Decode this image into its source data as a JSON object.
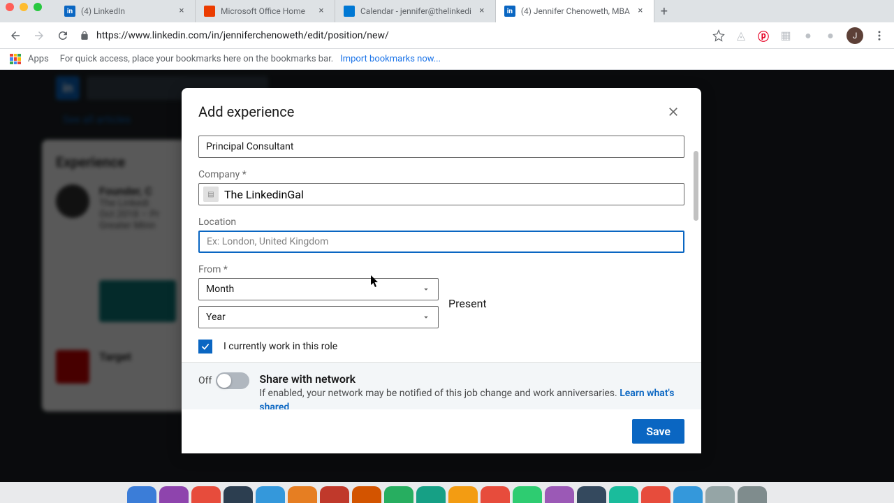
{
  "browser": {
    "tabs": [
      {
        "title": "(4) LinkedIn"
      },
      {
        "title": "Microsoft Office Home"
      },
      {
        "title": "Calendar - jennifer@thelinkedi"
      },
      {
        "title": "(4) Jennifer Chenoweth, MBA"
      }
    ],
    "url": "https://www.linkedin.com/in/jenniferchenoweth/edit/position/new/",
    "appsLabel": "Apps",
    "bookmarkHint": "For quick access, place your bookmarks here on the bookmarks bar.",
    "importLink": "Import bookmarks now...",
    "avatar": "J"
  },
  "background": {
    "seeAll": "See all articles",
    "sectionTitle": "Experience",
    "exp1_title": "Founder, C",
    "exp1_company": "The Linkedi",
    "exp2_title": "Target"
  },
  "modal": {
    "title": "Add experience",
    "titleValue": "Principal Consultant",
    "companyLabel": "Company",
    "companyValue": "The LinkedinGal",
    "locationLabel": "Location",
    "locationPlaceholder": "Ex: London, United Kingdom",
    "fromLabel": "From",
    "monthPlaceholder": "Month",
    "yearPlaceholder": "Year",
    "presentLabel": "Present",
    "currentRoleLabel": "I currently work in this role",
    "share": {
      "offLabel": "Off",
      "title": "Share with network",
      "desc": "If enabled, your network may be notified of this job change and work anniversaries. ",
      "link": "Learn what's shared"
    },
    "saveLabel": "Save"
  }
}
